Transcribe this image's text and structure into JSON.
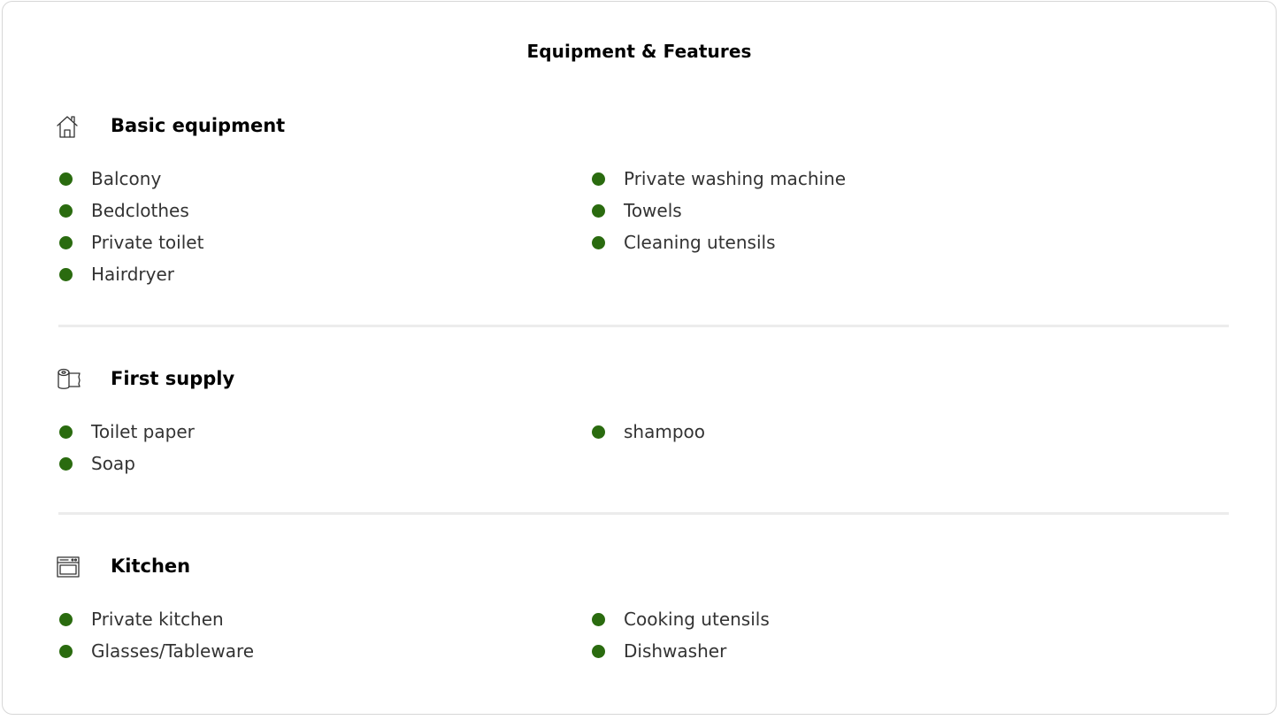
{
  "title": "Equipment & Features",
  "colors": {
    "bullet": "#2a6b0f",
    "divider": "#ececec",
    "border": "#d7d7d7"
  },
  "sections": [
    {
      "title": "Basic equipment",
      "icon": "house-icon",
      "left_items": [
        "Balcony",
        "Bedclothes",
        "Private toilet",
        "Hairdryer"
      ],
      "right_items": [
        "Private washing machine",
        "Towels",
        "Cleaning utensils"
      ]
    },
    {
      "title": "First supply",
      "icon": "toilet-paper-icon",
      "left_items": [
        "Toilet paper",
        "Soap"
      ],
      "right_items": [
        "shampoo"
      ]
    },
    {
      "title": "Kitchen",
      "icon": "oven-icon",
      "left_items": [
        "Private kitchen",
        "Glasses/Tableware"
      ],
      "right_items": [
        "Cooking utensils",
        "Dishwasher"
      ]
    }
  ]
}
